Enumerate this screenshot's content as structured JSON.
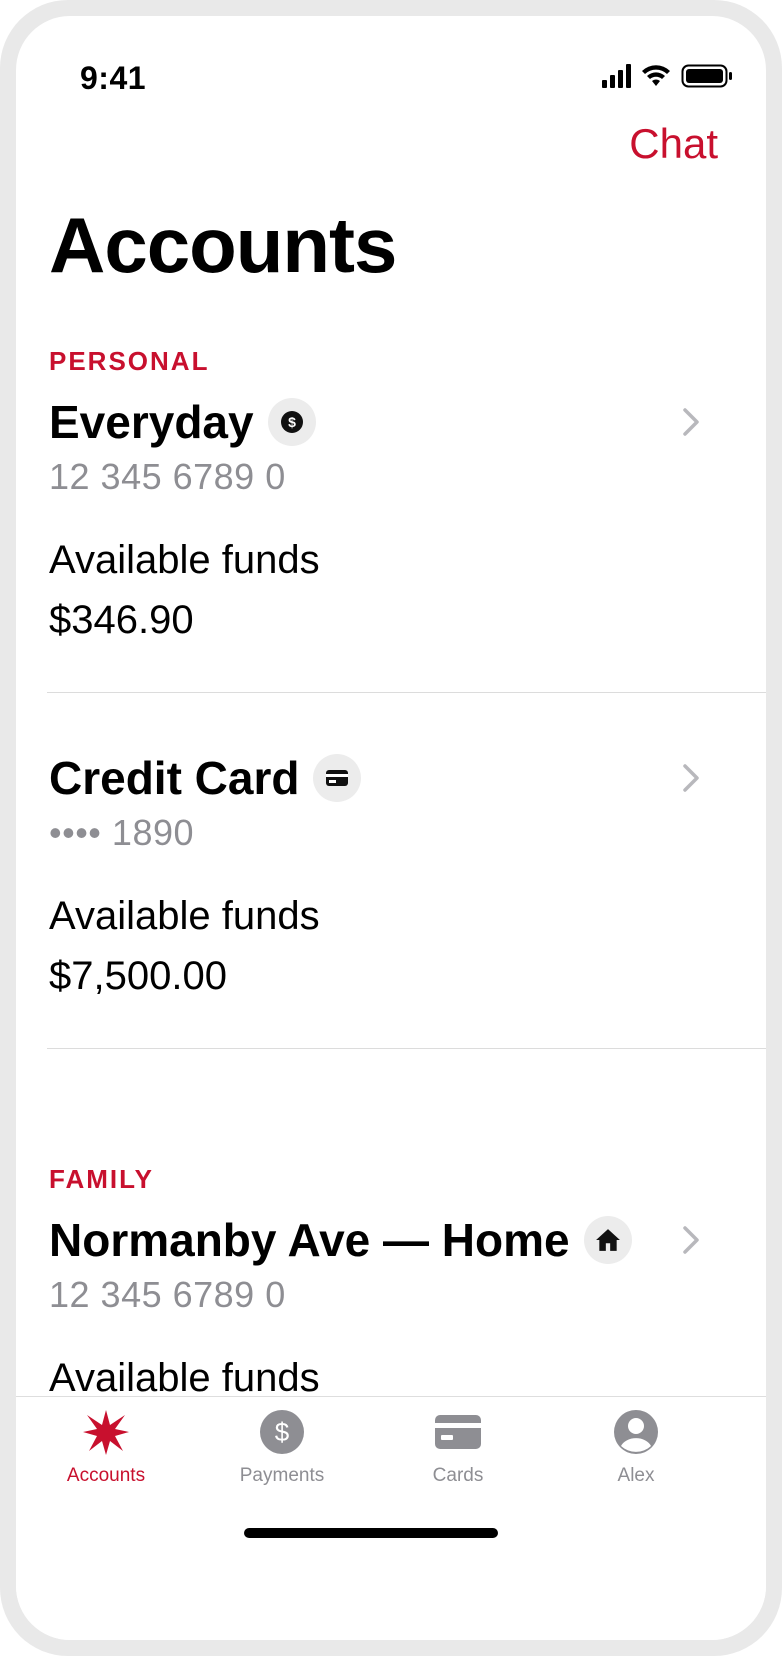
{
  "status_bar": {
    "time": "9:41"
  },
  "header": {
    "chat_label": "Chat",
    "title": "Accounts"
  },
  "sections": [
    {
      "label": "PERSONAL",
      "accounts": [
        {
          "name": "Everyday",
          "icon": "dollar-icon",
          "number": "12 345 6789 0",
          "available_label": "Available funds",
          "available_value": "$346.90"
        },
        {
          "name": "Credit Card",
          "icon": "card-icon",
          "number": "•••• 1890",
          "available_label": "Available funds",
          "available_value": "$7,500.00"
        }
      ]
    },
    {
      "label": "FAMILY",
      "accounts": [
        {
          "name": "Normanby Ave — Home",
          "icon": "home-icon",
          "number": "12 345 6789 0",
          "available_label": "Available funds"
        }
      ]
    }
  ],
  "tab_bar": {
    "tabs": [
      {
        "label": "Accounts",
        "icon": "star-logo-icon",
        "active": true
      },
      {
        "label": "Payments",
        "icon": "dollar-icon",
        "active": false
      },
      {
        "label": "Cards",
        "icon": "card-icon",
        "active": false
      },
      {
        "label": "Alex",
        "icon": "profile-icon",
        "active": false
      }
    ]
  },
  "colors": {
    "accent": "#c8102e",
    "secondary_text": "#8e8e93",
    "badge_bg": "#ececec"
  }
}
